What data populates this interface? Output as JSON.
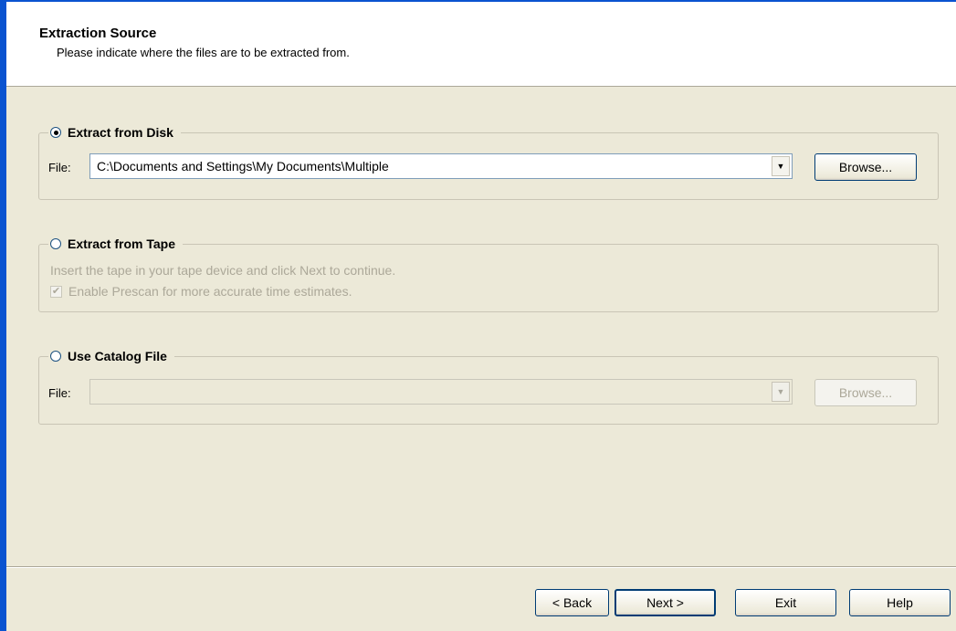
{
  "header": {
    "title": "Extraction Source",
    "subtitle": "Please indicate where the files are to be extracted from."
  },
  "disk": {
    "label": "Extract from Disk",
    "selected": true,
    "file_label": "File:",
    "file_value": "C:\\Documents and Settings\\My Documents\\Multiple",
    "browse_label": "Browse..."
  },
  "tape": {
    "label": "Extract from Tape",
    "selected": false,
    "instructions": "Insert the tape in your tape device and click Next to continue.",
    "prescan_label": "Enable Prescan for more accurate time estimates.",
    "prescan_checked": true
  },
  "catalog": {
    "label": "Use Catalog File",
    "selected": false,
    "file_label": "File:",
    "file_value": "",
    "browse_label": "Browse..."
  },
  "footer": {
    "back_label": "< Back",
    "next_label": "Next >",
    "exit_label": "Exit",
    "help_label": "Help"
  }
}
